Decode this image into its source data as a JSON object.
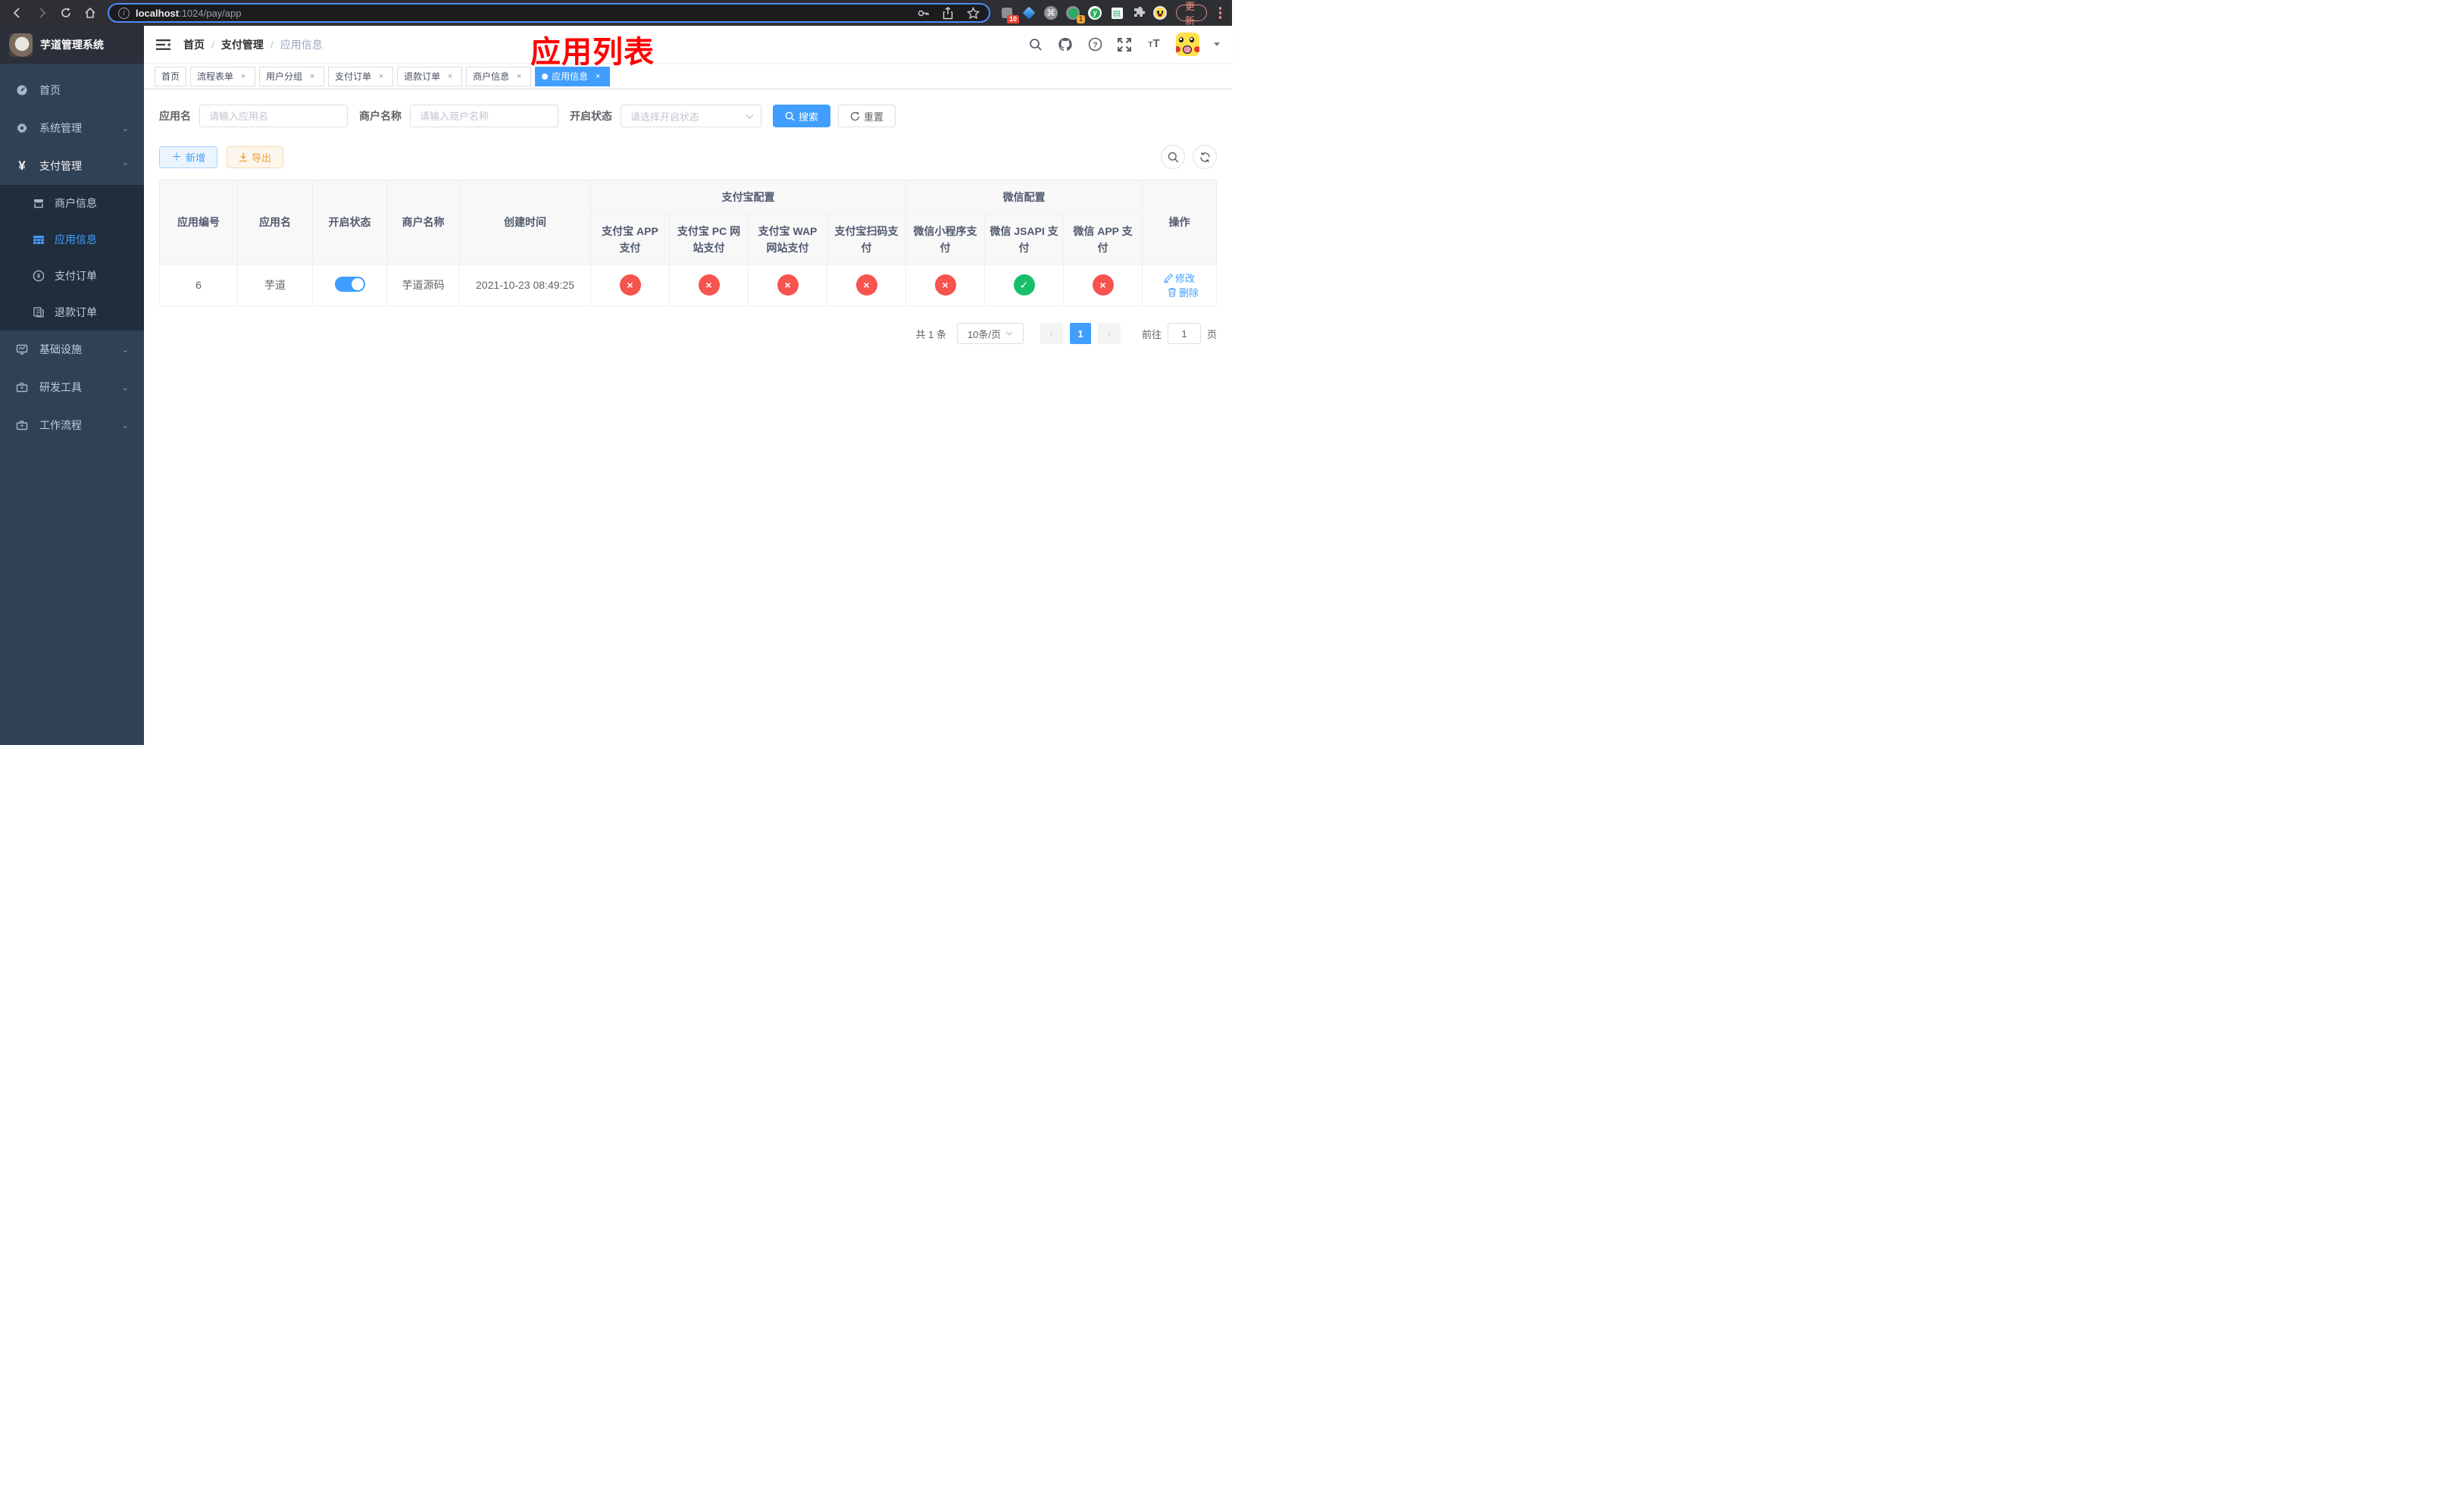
{
  "colors": {
    "primary": "#409eff",
    "success": "#19be6b",
    "danger": "#f7534f",
    "sidebar-bg": "#304156",
    "submenu-bg": "#1f2d3d"
  },
  "browser": {
    "url_host": "localhost",
    "url_path": ":1024/pay/app",
    "update_label": "更新",
    "ext_badge_grid": "10",
    "ext_badge_rec": "1",
    "ext_y": "y"
  },
  "sidebar": {
    "title": "芋道管理系统",
    "items": [
      {
        "label": "首页"
      },
      {
        "label": "系统管理"
      },
      {
        "label": "支付管理"
      },
      {
        "label": "商户信息"
      },
      {
        "label": "应用信息"
      },
      {
        "label": "支付订单"
      },
      {
        "label": "退款订单"
      },
      {
        "label": "基础设施"
      },
      {
        "label": "研发工具"
      },
      {
        "label": "工作流程"
      }
    ]
  },
  "breadcrumb": {
    "items": [
      {
        "label": "首页"
      },
      {
        "label": "支付管理"
      },
      {
        "label": "应用信息"
      }
    ],
    "separator": "/"
  },
  "tags": [
    {
      "label": "首页"
    },
    {
      "label": "流程表单"
    },
    {
      "label": "用户分组"
    },
    {
      "label": "支付订单"
    },
    {
      "label": "退款订单"
    },
    {
      "label": "商户信息"
    },
    {
      "label": "应用信息"
    }
  ],
  "annotation": "应用列表",
  "filters": {
    "app_name_label": "应用名",
    "app_name_placeholder": "请输入应用名",
    "merchant_label": "商户名称",
    "merchant_placeholder": "请输入商户名称",
    "status_label": "开启状态",
    "status_placeholder": "请选择开启状态",
    "search_label": "搜索",
    "reset_label": "重置"
  },
  "toolbar": {
    "add_label": "新增",
    "export_label": "导出"
  },
  "table": {
    "col_app_id": "应用编号",
    "col_app_name": "应用名",
    "col_status": "开启状态",
    "col_merchant": "商户名称",
    "col_created": "创建时间",
    "group_alipay": "支付宝配置",
    "group_wechat": "微信配置",
    "col_op": "操作",
    "pay_cols": [
      "支付宝 APP 支付",
      "支付宝 PC 网站支付",
      "支付宝 WAP 网站支付",
      "支付宝扫码支付",
      "微信小程序支付",
      "微信 JSAPI 支付",
      "微信 APP 支付"
    ],
    "row": {
      "id": "6",
      "name": "芋道",
      "enabled": true,
      "merchant": "芋道源码",
      "created": "2021-10-23 08:49:25",
      "statuses": [
        false,
        false,
        false,
        false,
        false,
        true,
        false
      ],
      "edit_label": "修改",
      "delete_label": "删除"
    }
  },
  "pagination": {
    "total": "共 1 条",
    "page_size": "10条/页",
    "page": "1",
    "goto_label": "前往",
    "goto_value": "1",
    "page_unit": "页"
  }
}
